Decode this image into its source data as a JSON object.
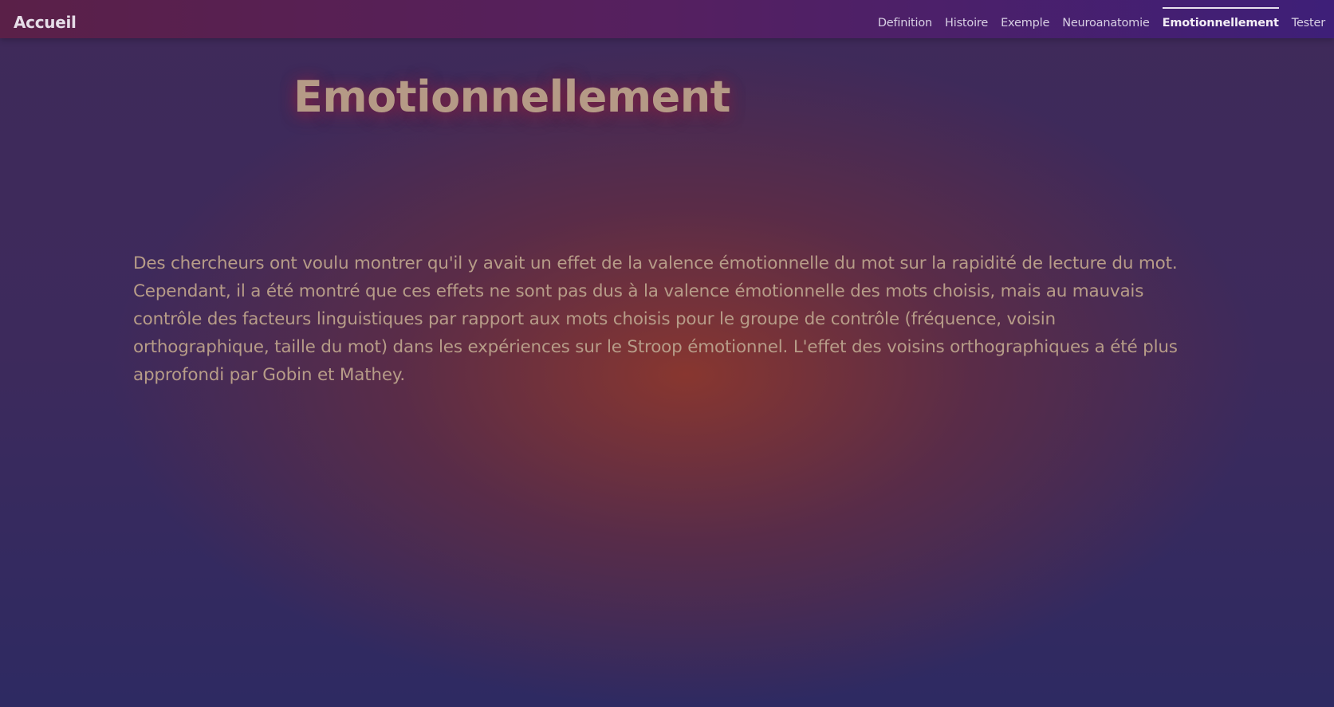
{
  "navbar": {
    "brand": "Accueil",
    "links": [
      {
        "label": "Definition",
        "active": false
      },
      {
        "label": "Histoire",
        "active": false
      },
      {
        "label": "Exemple",
        "active": false
      },
      {
        "label": "Neuroanatomie",
        "active": false
      },
      {
        "label": "Emotionnellement",
        "active": true
      },
      {
        "label": "Tester",
        "active": false
      }
    ]
  },
  "main": {
    "title": "Emotionnellement",
    "paragraph": "Des chercheurs ont voulu montrer qu'il y avait un effet de la valence émotionnelle du mot sur la rapidité de lecture du mot. Cependant, il a été montré que ces effets ne sont pas dus à la valence émotionnelle des mots choisis, mais au mauvais contrôle des facteurs linguistiques par rapport aux mots choisis pour le groupe de contrôle (fréquence, voisin orthographique, taille du mot) dans les expériences sur le Stroop émotionnel. L'effet des voisins orthographiques a été plus approfondi par Gobin et Mathey."
  },
  "colors": {
    "title_text": "#b59a86",
    "body_text": "#b79c88",
    "nav_text": "#d8d0e4",
    "nav_gradient_start": "#5a2048",
    "nav_gradient_end": "#3e1f78"
  }
}
